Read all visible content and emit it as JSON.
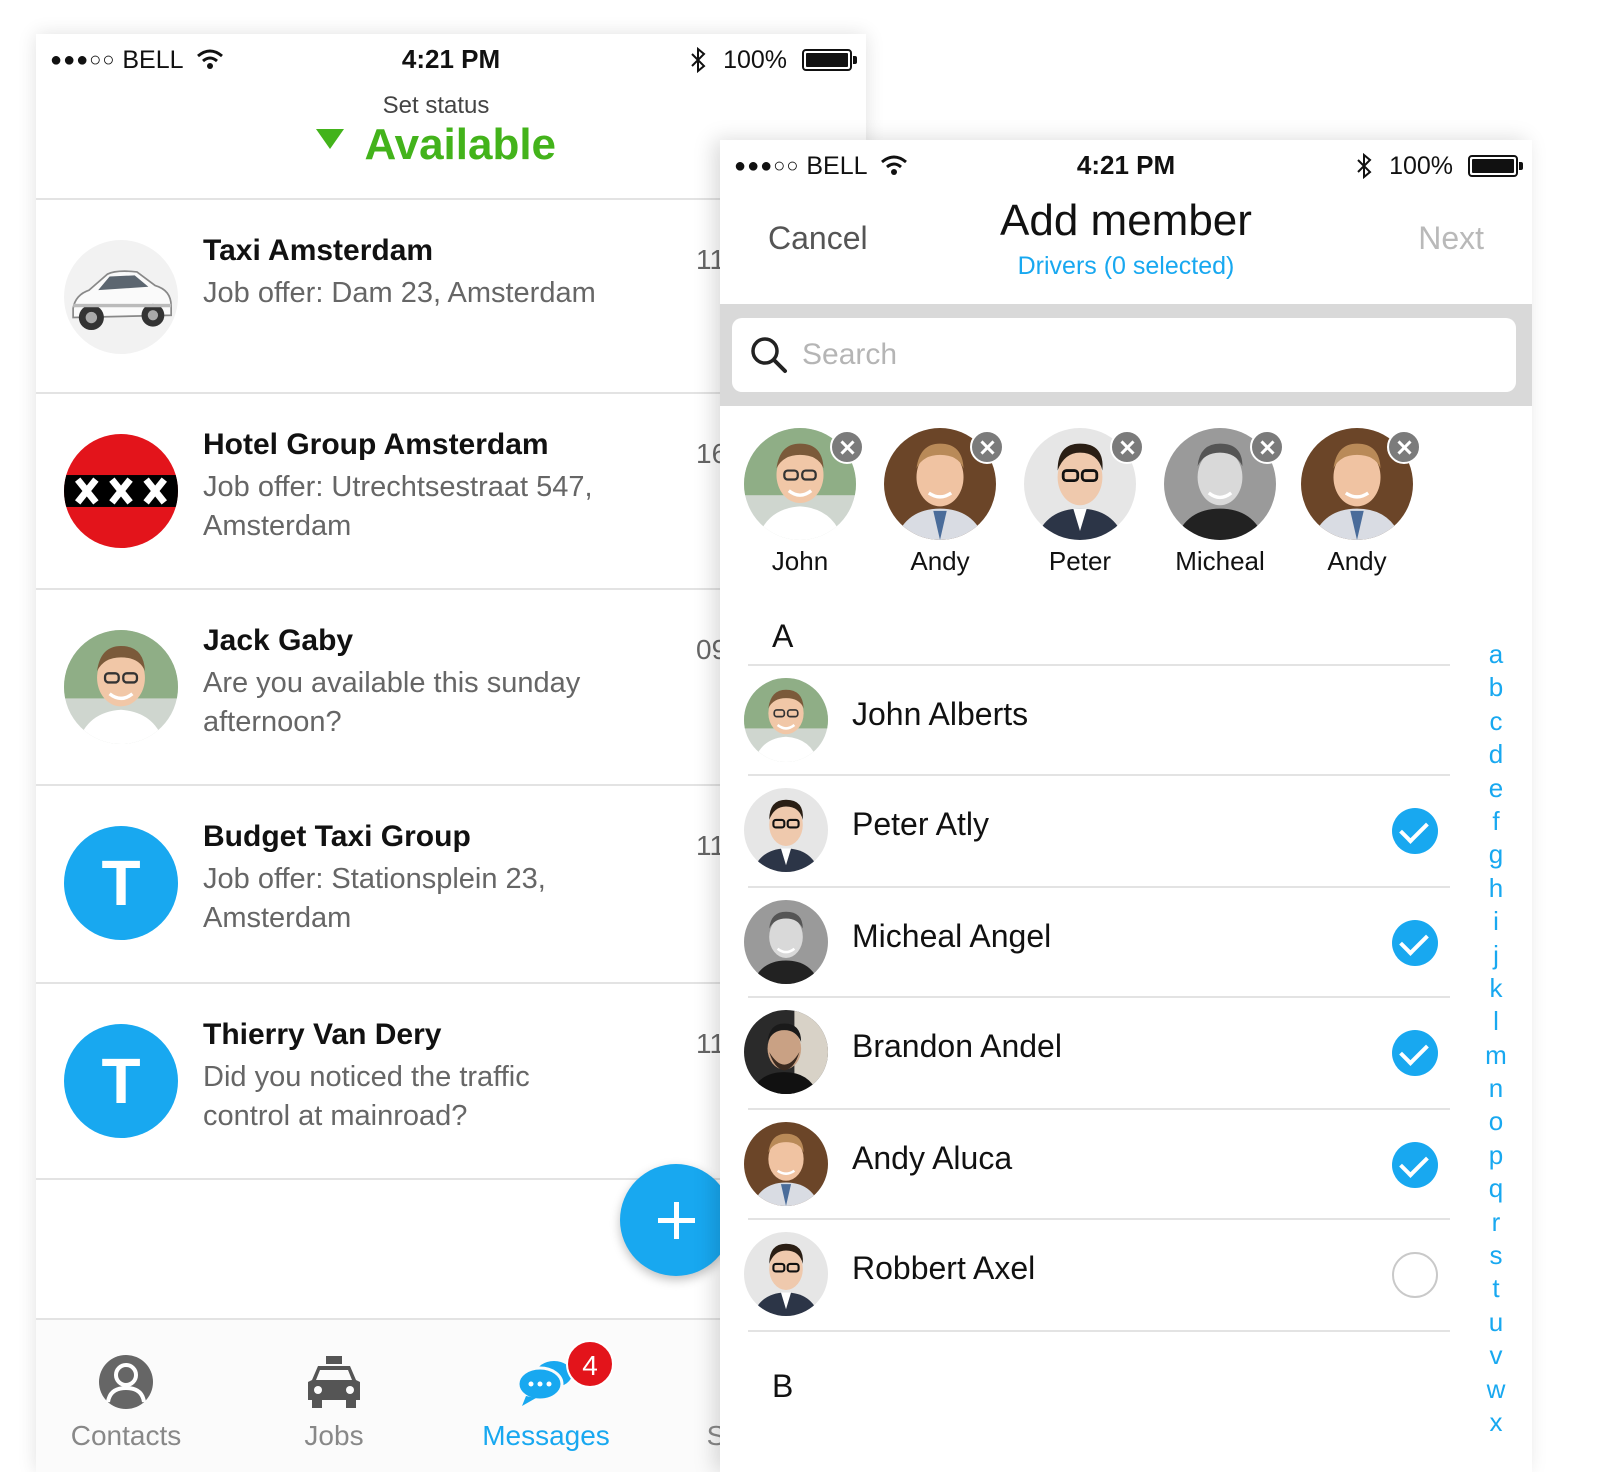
{
  "screen1": {
    "statusbar": {
      "carrier": "BELL",
      "time": "4:21 PM",
      "battery": "100%"
    },
    "header": {
      "title": "Set status",
      "status": "Available",
      "status_color": "#43b31b"
    },
    "messages": [
      {
        "name": "Taxi Amsterdam",
        "preview": "Job offer: Dam 23, Amsterdam",
        "time": "11",
        "avatar": "car-photo"
      },
      {
        "name": "Hotel Group Amsterdam",
        "preview": "Job offer: Utrechtsestraat 547, Amsterdam",
        "time": "16",
        "avatar": "amsterdam-flag"
      },
      {
        "name": "Jack Gaby",
        "preview": "Are you available this sunday afternoon?",
        "time": "09",
        "avatar": "person-photo"
      },
      {
        "name": "Budget Taxi Group",
        "preview": "Job offer: Stationsplein 23, Amsterdam",
        "time": "11",
        "avatar": "initial",
        "initial": "T"
      },
      {
        "name": "Thierry Van Dery",
        "preview": "Did you noticed the traffic control at mainroad?",
        "time": "11",
        "avatar": "initial",
        "initial": "T"
      }
    ],
    "tabs": [
      {
        "label": "Contacts",
        "icon": "user-icon",
        "active": false
      },
      {
        "label": "Jobs",
        "icon": "taxi-icon",
        "active": false
      },
      {
        "label": "Messages",
        "icon": "chat-icon",
        "active": true,
        "badge": "4"
      },
      {
        "label": "S",
        "icon": "",
        "active": false
      }
    ],
    "accent": "#18a8f0"
  },
  "screen2": {
    "statusbar": {
      "carrier": "BELL",
      "time": "4:21 PM",
      "battery": "100%"
    },
    "nav": {
      "cancel": "Cancel",
      "title": "Add member",
      "subtitle": "Drivers (0 selected)",
      "next": "Next"
    },
    "search": {
      "placeholder": "Search",
      "value": ""
    },
    "selected": [
      {
        "name": "John"
      },
      {
        "name": "Andy"
      },
      {
        "name": "Peter"
      },
      {
        "name": "Micheal"
      },
      {
        "name": "Andy"
      }
    ],
    "sections": [
      {
        "header": "A",
        "rows": [
          {
            "name": "John Alberts",
            "checked": null
          },
          {
            "name": "Peter Atly",
            "checked": true
          },
          {
            "name": "Micheal Angel",
            "checked": true
          },
          {
            "name": "Brandon Andel",
            "checked": true
          },
          {
            "name": "Andy Aluca",
            "checked": true
          },
          {
            "name": "Robbert Axel",
            "checked": false
          }
        ]
      },
      {
        "header": "B",
        "rows": []
      }
    ],
    "index_letters": [
      "a",
      "b",
      "c",
      "d",
      "e",
      "f",
      "g",
      "h",
      "i",
      "j",
      "k",
      "l",
      "m",
      "n",
      "o",
      "p",
      "q",
      "r",
      "s",
      "t",
      "u",
      "v",
      "w",
      "x"
    ]
  }
}
